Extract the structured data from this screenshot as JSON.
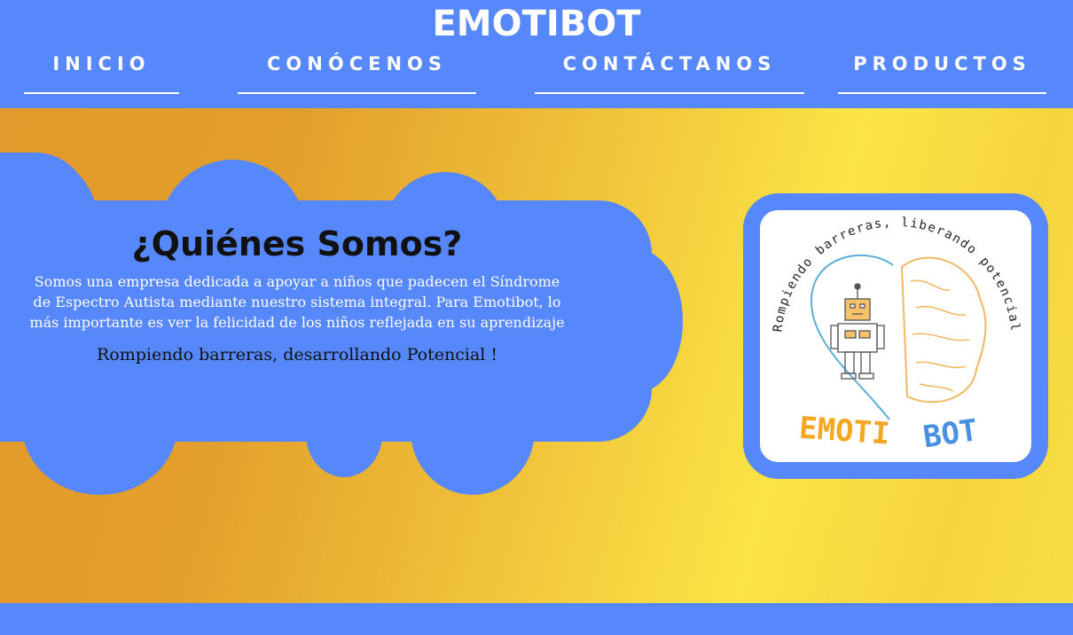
{
  "header": {
    "title": "EMOTIBOT",
    "nav": [
      {
        "label": "INICIO"
      },
      {
        "label": "CONÓCENOS"
      },
      {
        "label": "CONTÁCTANOS"
      },
      {
        "label": "PRODUCTOS"
      }
    ]
  },
  "about": {
    "heading": "¿Quiénes Somos?",
    "body": "Somos una empresa dedicada a apoyar a niños que padecen el Síndrome de Espectro Autista mediante nuestro sistema integral. Para Emotibot, lo más importante es ver la felicidad de los niños reflejada en su aprendizaje",
    "slogan": "Rompiendo barreras, desarrollando Potencial !"
  },
  "logo": {
    "arc_text": "Rompiendo barreras, liberando potencial",
    "word_orange": "EMOTI",
    "word_blue": "BOT"
  },
  "colors": {
    "primary_blue": "#5687fb",
    "gradient_orange": "#e3992b",
    "gradient_yellow": "#fbe446"
  }
}
